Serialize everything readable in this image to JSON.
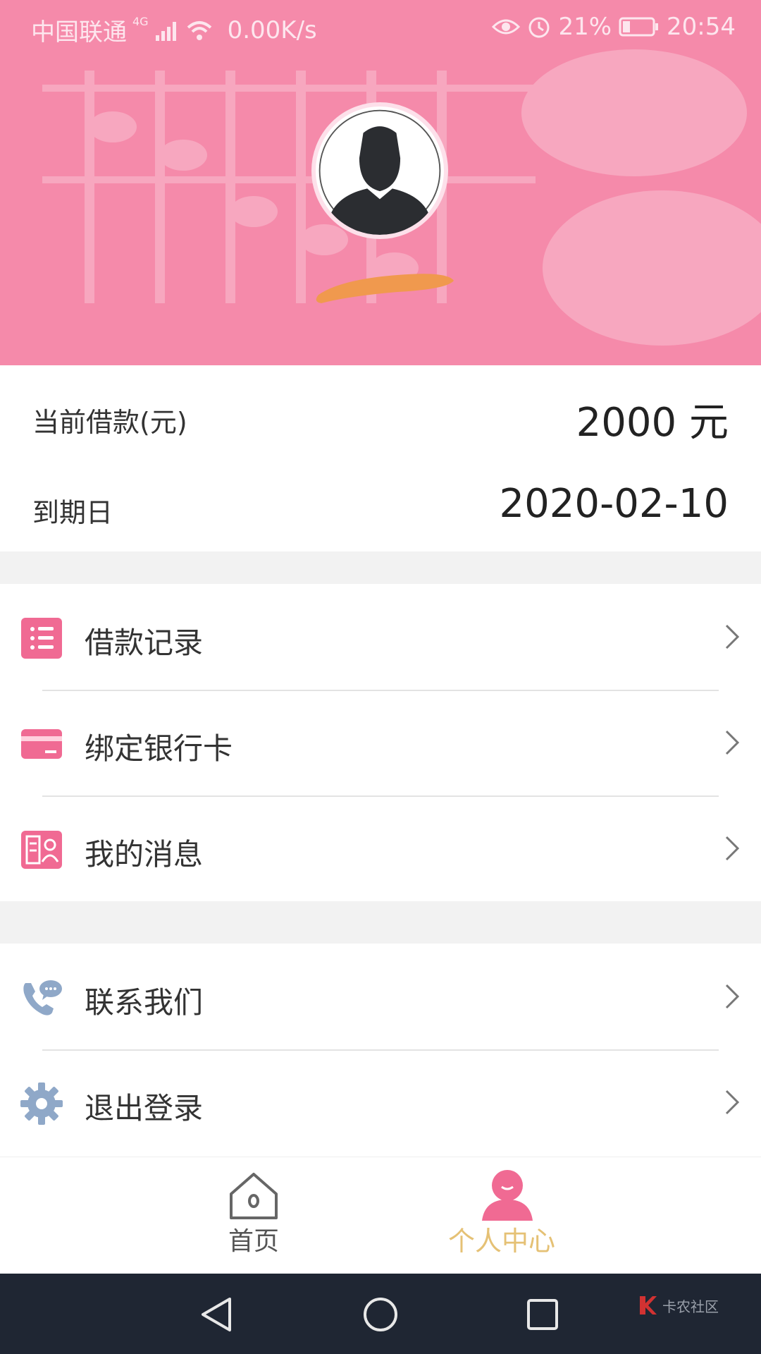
{
  "status_bar": {
    "carrier": "中国联通",
    "network": "4G",
    "speed": "0.00K/s",
    "battery": "21%",
    "time": "20:54"
  },
  "loan": {
    "current_label": "当前借款(元)",
    "current_value": "2000 元",
    "due_label": "到期日",
    "due_value": "2020-02-10"
  },
  "menu_group1": [
    {
      "label": "借款记录",
      "icon": "list-icon"
    },
    {
      "label": "绑定银行卡",
      "icon": "bank-card-icon"
    },
    {
      "label": "我的消息",
      "icon": "message-contact-icon"
    }
  ],
  "menu_group2": [
    {
      "label": "联系我们",
      "icon": "phone-chat-icon"
    },
    {
      "label": "退出登录",
      "icon": "gear-icon"
    }
  ],
  "tabs": {
    "home_label": "首页",
    "profile_label": "个人中心"
  },
  "watermark": "卡农社区",
  "colors": {
    "brand_pink": "#f58aaa",
    "accent_pink": "#f06a93",
    "active_tab_text": "#e5c175",
    "icon_blue": "#8fa8c8"
  }
}
